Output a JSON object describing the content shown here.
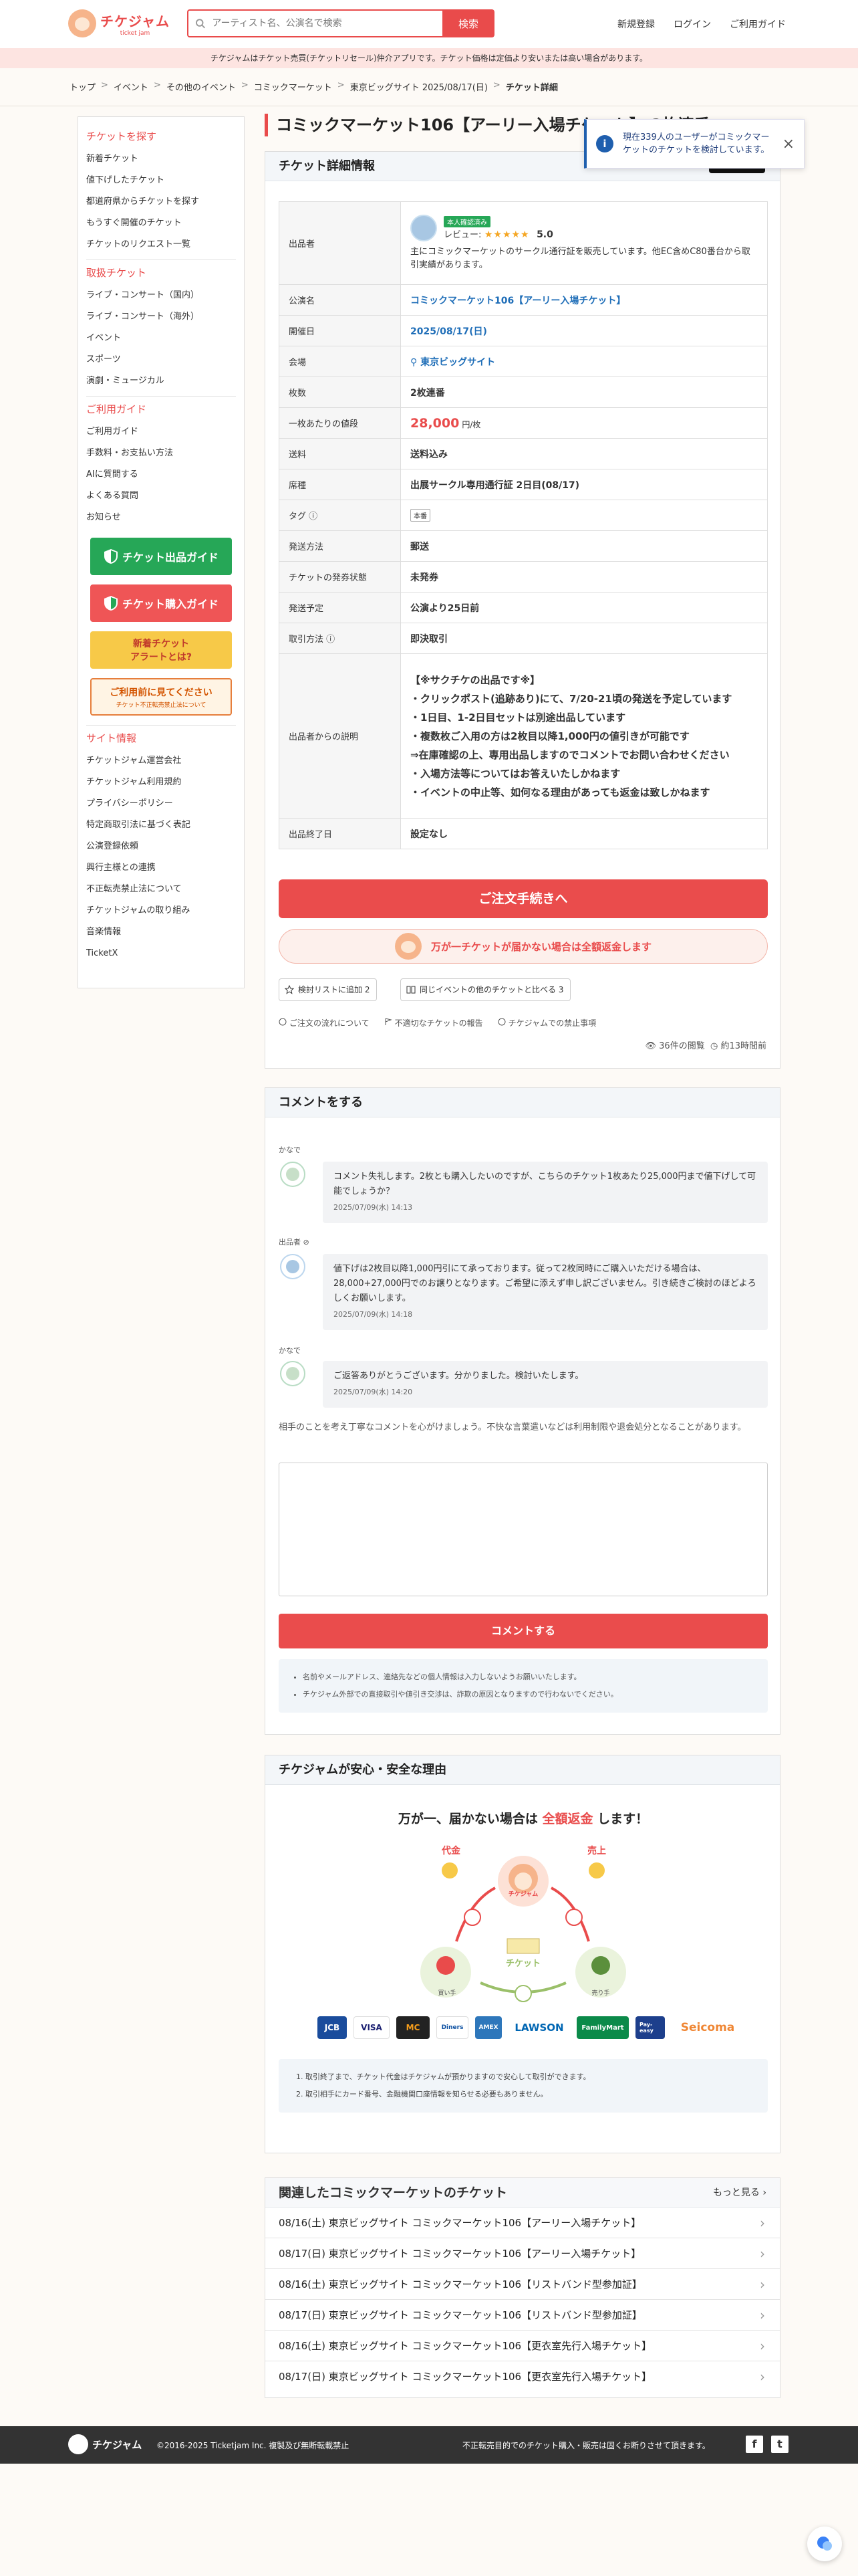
{
  "header": {
    "logo_main": "チケジャム",
    "logo_sub": "ticket jam",
    "search_placeholder": "アーティスト名、公演名で検索",
    "search_button": "検索",
    "links": [
      "新規登録",
      "ログイン",
      "ご利用ガイド"
    ]
  },
  "notice": "チケジャムはチケット売買(チケットリセール)仲介アプリです。チケット価格は定価より安いまたは高い場合があります。",
  "breadcrumb": [
    "トップ",
    "イベント",
    "その他のイベント",
    "コミックマーケット",
    "東京ビッグサイト 2025/08/17(日)",
    "チケット詳細"
  ],
  "sidebar": {
    "sections": [
      {
        "heading": "チケットを探す",
        "items": [
          "新着チケット",
          "値下げしたチケット",
          "都道府県からチケットを探す",
          "もうすぐ開催のチケット",
          "チケットのリクエスト一覧"
        ]
      },
      {
        "heading": "取扱チケット",
        "items": [
          "ライブ・コンサート（国内）",
          "ライブ・コンサート（海外）",
          "イベント",
          "スポーツ",
          "演劇・ミュージカル"
        ]
      },
      {
        "heading": "ご利用ガイド",
        "items": [
          "ご利用ガイド",
          "手数料・お支払い方法",
          "AIに質問する",
          "よくある質問",
          "お知らせ"
        ]
      }
    ],
    "banners": {
      "sell": "チケット出品ガイド",
      "buy": "チケット購入ガイド",
      "alert_line1": "新着チケット",
      "alert_line2": "アラートとは?",
      "caution_line1": "ご利用前に見てください",
      "caution_line2": "チケット不正転売禁止法について"
    },
    "site_heading": "サイト情報",
    "site_items": [
      "チケットジャム運営会社",
      "チケットジャム利用規約",
      "プライバシーポリシー",
      "特定商取引法に基づく表記",
      "公演登録依頼",
      "興行主様との連携",
      "不正転売禁止法について",
      "チケットジャムの取り組み",
      "音楽情報",
      "TicketX"
    ]
  },
  "page_title": "コミックマーケット106【アーリー入場チケット】 2枚連番",
  "toast": {
    "text": "現在339人のユーザーがコミックマーケットのチケットを検討しています。",
    "icon": "info-icon"
  },
  "detail": {
    "heading": "チケット詳細情報",
    "share_label": "シェア",
    "seller_label": "出品者",
    "seller_badge": "本人確認済み",
    "seller_review_label": "レビュー:",
    "seller_stars": "★★★★★",
    "seller_rating": "5.0",
    "seller_desc": "主にコミックマーケットのサークル通行証を販売しています。他EC含めC80番台から取引実績があります。",
    "rows": [
      {
        "label": "公演名",
        "value": "コミックマーケット106【アーリー入場チケット】"
      },
      {
        "label": "開催日",
        "value": "2025/08/17(日)"
      },
      {
        "label": "会場",
        "value": "東京ビッグサイト"
      },
      {
        "label": "枚数",
        "value": "2枚連番"
      },
      {
        "label": "一枚あたりの値段",
        "value": "28,000",
        "unit": "円/枚"
      },
      {
        "label": "送料",
        "value": "送料込み"
      },
      {
        "label": "席種",
        "value": "出展サークル専用通行証 2日目(08/17)"
      },
      {
        "label": "タグ",
        "tags": [
          "本番"
        ]
      },
      {
        "label": "発送方法",
        "value": "郵送"
      },
      {
        "label": "チケットの発券状態",
        "value": "未発券"
      },
      {
        "label": "発送予定",
        "value": "公演より25日前"
      },
      {
        "label": "取引方法",
        "value": "即決取引"
      }
    ],
    "desc_label": "出品者からの説明",
    "desc_lines": [
      "【※サクチケの出品です※】",
      "・クリックポスト(追跡あり)にて、7/20-21頃の発送を予定しています",
      "・1日目、1-2日目セットは別途出品しています",
      "・複数枚ご入用の方は2枚目以降1,000円の値引きが可能です",
      "⇒在庫確認の上、専用出品しますのでコメントでお問い合わせください",
      "・入場方法等についてはお答えいたしかねます",
      "・イベントの中止等、如何なる理由があっても返金は致しかねます"
    ],
    "end_label": "出品終了日",
    "end_value": "設定なし",
    "order_button": "ご注文手続きへ",
    "guarantee": "万が一チケットが届かない場合は全額返金します",
    "watch_button": "検討リストに追加 2",
    "compare_button": "同じイベントの他のチケットと比べる 3",
    "links": [
      "ご注文の流れについて",
      "不適切なチケットの報告",
      "チケジャムでの禁止事項"
    ],
    "views": "36件の閲覧",
    "posted": "約13時間前"
  },
  "comments": {
    "heading": "コメントをする",
    "items": [
      {
        "name": "かなで",
        "text": "コメント失礼します。2枚とも購入したいのですが、こちらのチケット1枚あたり25,000円まで値下げして可能でしょうか？",
        "date": "2025/07/09(水) 14:13"
      },
      {
        "name": "出品者",
        "text": "値下げは2枚目以降1,000円引にて承っております。従って2枚同時にご購入いただける場合は、28,000+27,000円でのお譲りとなります。ご希望に添えず申し訳ございません。引き続きご検討のほどよろしくお願いします。",
        "date": "2025/07/09(水) 14:18"
      },
      {
        "name": "かなで",
        "text": "ご返答ありがとうございます。分かりました。検討いたします。",
        "date": "2025/07/09(水) 14:20"
      }
    ],
    "note": "相手のことを考え丁寧なコメントを心がけましょう。不快な言葉遣いなどは利用制限や退会処分となることがあります。",
    "submit": "コメントする",
    "info": [
      "名前やメールアドレス、連絡先などの個人情報は入力しないようお願いいたします。",
      "チケジャム外部での直接取引や値引き交渉は、詐欺の原因となりますので行わないでください。"
    ]
  },
  "safety": {
    "heading": "チケジャムが安心・安全な理由",
    "title_pre": "万が一、届かない場合は",
    "title_hl": "全額返金",
    "title_post": "します！",
    "diagram": {
      "daikin": "代金",
      "uriage": "売上",
      "center": "チケジャム",
      "ticket": "チケット",
      "buyer": "買い手",
      "seller": "売り手"
    },
    "pay_logos": [
      "JCB",
      "VISA",
      "MC",
      "Diners",
      "AMEX",
      "LAWSON",
      "FamilyMart",
      "Pay-easy",
      "Seicoma"
    ],
    "steps": [
      "取引終了まで、チケット代金はチケジャムが預かりますので安心して取引ができます。",
      "取引相手にカード番号、金融機関口座情報を知らせる必要もありません。"
    ]
  },
  "related": {
    "heading": "関連したコミックマーケットのチケット",
    "more": "もっと見る",
    "rows": [
      "08/16(土) 東京ビッグサイト コミックマーケット106【アーリー入場チケット】",
      "08/17(日) 東京ビッグサイト コミックマーケット106【アーリー入場チケット】",
      "08/16(土) 東京ビッグサイト コミックマーケット106【リストバンド型参加証】",
      "08/17(日) 東京ビッグサイト コミックマーケット106【リストバンド型参加証】",
      "08/16(土) 東京ビッグサイト コミックマーケット106【更衣室先行入場チケット】",
      "08/17(日) 東京ビッグサイト コミックマーケット106【更衣室先行入場チケット】"
    ]
  },
  "footer": {
    "logo": "チケジャム",
    "copyright": "©2016-2025 Ticketjam Inc. 複製及び無断転載禁止",
    "message": "不正転売目的でのチケット購入・販売は固くお断りさせて頂きます。",
    "facebook": "f",
    "twitter": "t"
  },
  "colors": {
    "accent": "#e94b4b",
    "link_blue": "#1f6eb8",
    "green": "#26a757"
  }
}
